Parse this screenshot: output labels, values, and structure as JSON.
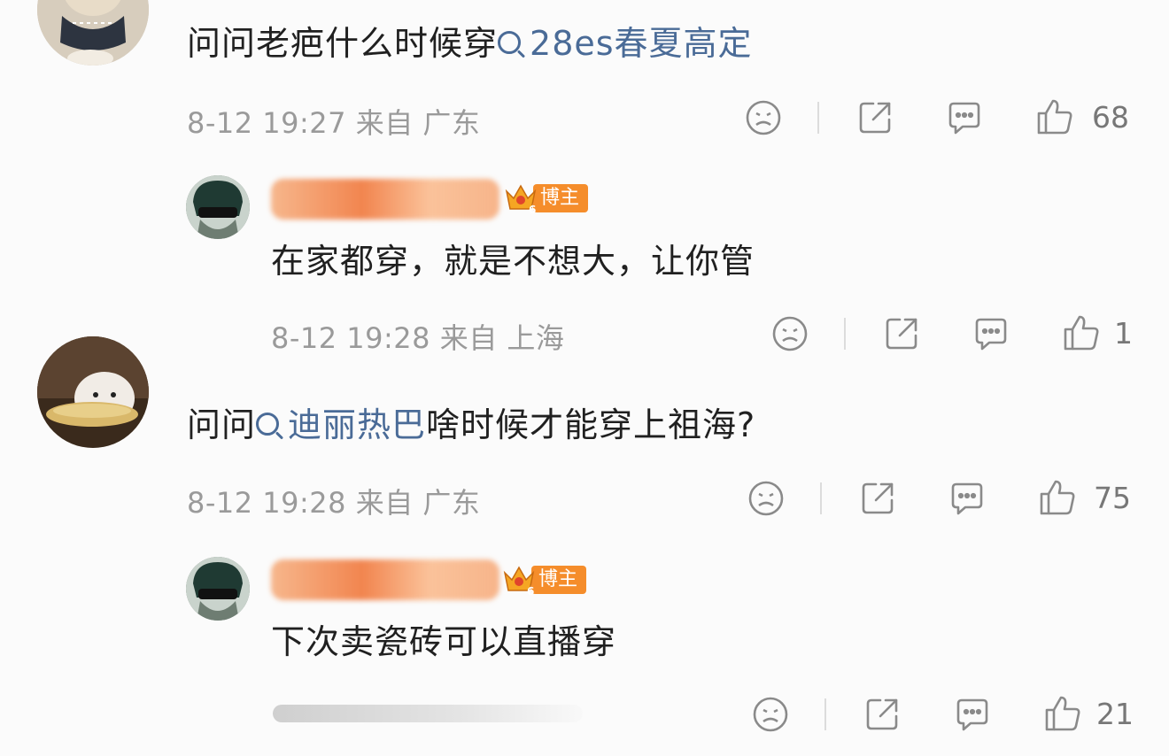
{
  "comments": [
    {
      "text_prefix": "问问老疤什么时候穿",
      "topic": "28es春夏高定",
      "text_suffix": "",
      "time": "8-12 19:27",
      "location": "来自 广东",
      "likes": "68",
      "reply": {
        "name_visible": "F",
        "badge": "博主",
        "text": "在家都穿，就是不想大，让你管",
        "time": "8-12 19:28",
        "location": "来自 上海",
        "likes": "1"
      }
    },
    {
      "text_prefix": "问问",
      "topic": "迪丽热巴",
      "text_suffix": "啥时候才能穿上祖海?",
      "time": "8-12 19:28",
      "location": "来自 广东",
      "likes": "75",
      "reply": {
        "name_visible": "F",
        "badge": "博主",
        "text": "下次卖瓷砖可以直播穿",
        "time": "",
        "location": "",
        "likes": "21"
      }
    }
  ],
  "icons": [
    "sad-face-icon",
    "share-icon",
    "comment-icon",
    "thumb-up-icon",
    "crown-icon",
    "search-icon"
  ],
  "colors": {
    "topic": "#4a6b97",
    "badge": "#f58d2b",
    "meta": "#9a9a9a"
  }
}
